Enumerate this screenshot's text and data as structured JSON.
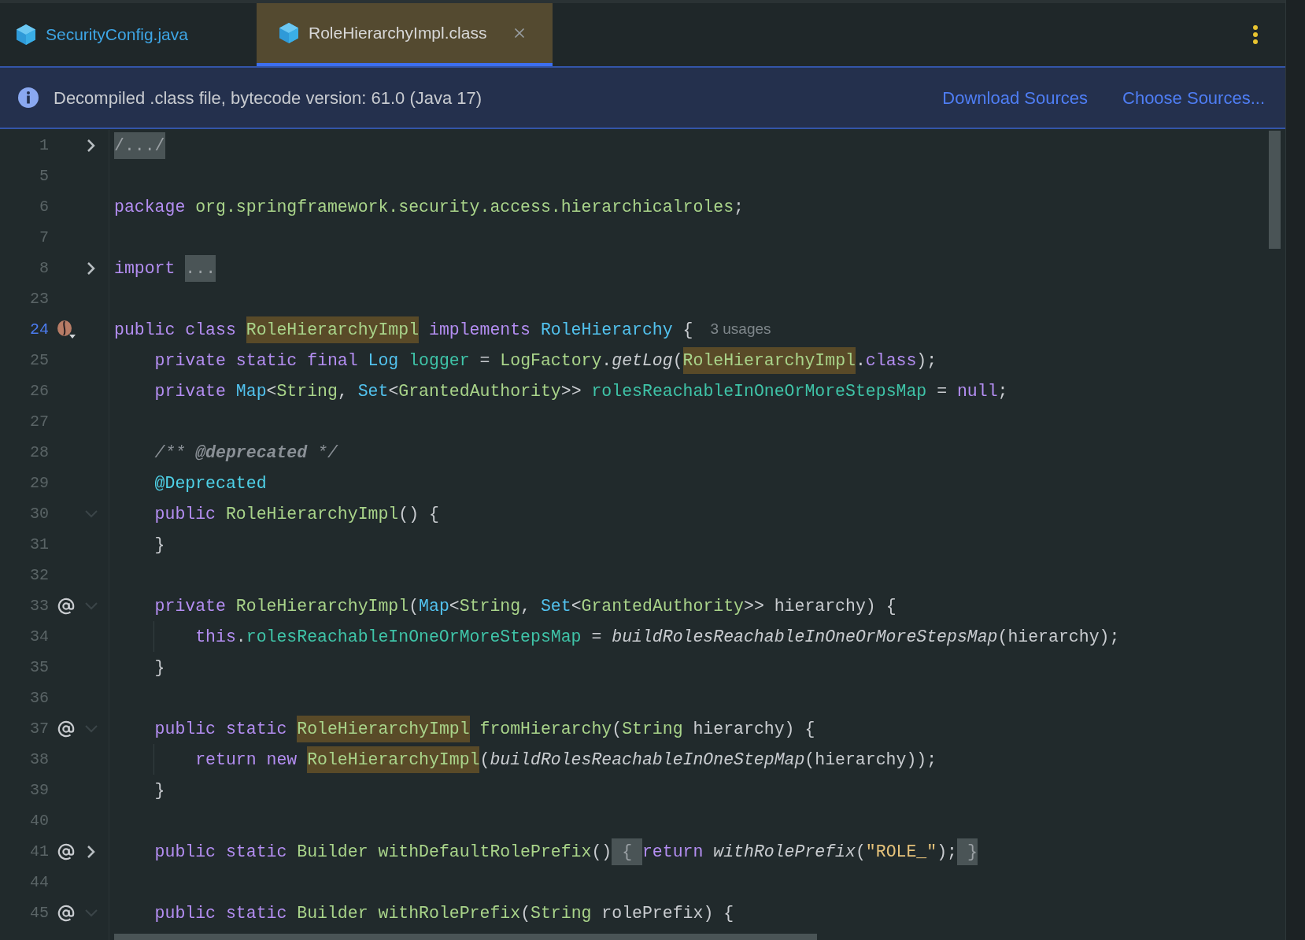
{
  "tabs": [
    {
      "label": "SecurityConfig.java",
      "selected": false,
      "closable": false
    },
    {
      "label": "RoleHierarchyImpl.class",
      "selected": true,
      "closable": true
    }
  ],
  "banner": {
    "message": "Decompiled .class file, bytecode version: 61.0 (Java 17)",
    "links": [
      "Download Sources",
      "Choose Sources..."
    ]
  },
  "lines": [
    {
      "number": "1",
      "current": false,
      "fold": {
        "collapsed": true
      },
      "tokens": [
        {
          "kind": "fold_marker",
          "text": "/.../"
        }
      ]
    },
    {
      "number": "5",
      "current": false
    },
    {
      "number": "6",
      "current": false,
      "tokens": [
        {
          "kind": "keyword",
          "text": "package "
        },
        {
          "kind": "package",
          "text": "org.springframework.security.access.hierarchicalroles"
        },
        {
          "kind": "plain",
          "text": ";"
        }
      ]
    },
    {
      "number": "7",
      "current": false
    },
    {
      "number": "8",
      "current": false,
      "fold": {
        "collapsed": true
      },
      "tokens": [
        {
          "kind": "keyword",
          "text": "import "
        },
        {
          "kind": "fold_marker",
          "text": "..."
        }
      ]
    },
    {
      "number": "23",
      "current": false
    },
    {
      "number": "24",
      "current": true,
      "gutter": {
        "kind": "bean"
      },
      "hint": "3 usages",
      "tokens": [
        {
          "kind": "keyword",
          "text": "public class "
        },
        {
          "kind": "class_match",
          "text": "RoleHierarchyImpl"
        },
        {
          "kind": "keyword",
          "text": " implements "
        },
        {
          "kind": "interface",
          "text": "RoleHierarchy"
        },
        {
          "kind": "plain",
          "text": " {"
        }
      ]
    },
    {
      "number": "25",
      "current": false,
      "tokens": [
        {
          "kind": "keyword",
          "text": "    private static final "
        },
        {
          "kind": "interface",
          "text": "Log"
        },
        {
          "kind": "field",
          "text": " logger"
        },
        {
          "kind": "plain",
          "text": " = "
        },
        {
          "kind": "class",
          "text": "LogFactory"
        },
        {
          "kind": "plain",
          "text": "."
        },
        {
          "kind": "static_call",
          "text": "getLog"
        },
        {
          "kind": "plain",
          "text": "("
        },
        {
          "kind": "class_match",
          "text": "RoleHierarchyImpl"
        },
        {
          "kind": "plain",
          "text": "."
        },
        {
          "kind": "keyword",
          "text": "class"
        },
        {
          "kind": "plain",
          "text": ");"
        }
      ]
    },
    {
      "number": "26",
      "current": false,
      "tokens": [
        {
          "kind": "keyword",
          "text": "    private "
        },
        {
          "kind": "interface",
          "text": "Map"
        },
        {
          "kind": "plain",
          "text": "<"
        },
        {
          "kind": "class",
          "text": "String"
        },
        {
          "kind": "plain",
          "text": ", "
        },
        {
          "kind": "interface",
          "text": "Set"
        },
        {
          "kind": "plain",
          "text": "<"
        },
        {
          "kind": "class",
          "text": "GrantedAuthority"
        },
        {
          "kind": "plain",
          "text": ">> "
        },
        {
          "kind": "field",
          "text": "rolesReachableInOneOrMoreStepsMap"
        },
        {
          "kind": "plain",
          "text": " = "
        },
        {
          "kind": "keyword",
          "text": "null"
        },
        {
          "kind": "plain",
          "text": ";"
        }
      ]
    },
    {
      "number": "27",
      "current": false
    },
    {
      "number": "28",
      "current": false,
      "tokens": [
        {
          "kind": "comment",
          "text": "    /** "
        },
        {
          "kind": "comment_tag",
          "text": "@deprecated"
        },
        {
          "kind": "comment",
          "text": " */"
        }
      ]
    },
    {
      "number": "29",
      "current": false,
      "tokens": [
        {
          "kind": "annotation",
          "text": "    @Deprecated"
        }
      ]
    },
    {
      "number": "30",
      "current": false,
      "fold": {
        "collapsed": false
      },
      "tokens": [
        {
          "kind": "keyword",
          "text": "    public "
        },
        {
          "kind": "method",
          "text": "RoleHierarchyImpl"
        },
        {
          "kind": "plain",
          "text": "() {"
        }
      ]
    },
    {
      "number": "31",
      "current": false,
      "tokens": [
        {
          "kind": "plain",
          "text": "    }"
        }
      ]
    },
    {
      "number": "32",
      "current": false
    },
    {
      "number": "33",
      "current": false,
      "gutter": {
        "kind": "at"
      },
      "fold": {
        "collapsed": false
      },
      "tokens": [
        {
          "kind": "keyword",
          "text": "    private "
        },
        {
          "kind": "method",
          "text": "RoleHierarchyImpl"
        },
        {
          "kind": "plain",
          "text": "("
        },
        {
          "kind": "interface",
          "text": "Map"
        },
        {
          "kind": "plain",
          "text": "<"
        },
        {
          "kind": "class",
          "text": "String"
        },
        {
          "kind": "plain",
          "text": ", "
        },
        {
          "kind": "interface",
          "text": "Set"
        },
        {
          "kind": "plain",
          "text": "<"
        },
        {
          "kind": "class",
          "text": "GrantedAuthority"
        },
        {
          "kind": "plain",
          "text": ">> hierarchy) {"
        }
      ]
    },
    {
      "number": "34",
      "current": false,
      "tokens": [
        {
          "kind": "keyword",
          "text": "        this"
        },
        {
          "kind": "plain",
          "text": "."
        },
        {
          "kind": "field",
          "text": "rolesReachableInOneOrMoreStepsMap"
        },
        {
          "kind": "plain",
          "text": " = "
        },
        {
          "kind": "static_call",
          "text": "buildRolesReachableInOneOrMoreStepsMap"
        },
        {
          "kind": "plain",
          "text": "(hierarchy);"
        }
      ]
    },
    {
      "number": "35",
      "current": false,
      "tokens": [
        {
          "kind": "plain",
          "text": "    }"
        }
      ]
    },
    {
      "number": "36",
      "current": false
    },
    {
      "number": "37",
      "current": false,
      "gutter": {
        "kind": "at"
      },
      "fold": {
        "collapsed": false
      },
      "tokens": [
        {
          "kind": "keyword",
          "text": "    public static "
        },
        {
          "kind": "class_match",
          "text": "RoleHierarchyImpl"
        },
        {
          "kind": "method",
          "text": " fromHierarchy"
        },
        {
          "kind": "plain",
          "text": "("
        },
        {
          "kind": "class",
          "text": "String"
        },
        {
          "kind": "plain",
          "text": " hierarchy) {"
        }
      ]
    },
    {
      "number": "38",
      "current": false,
      "tokens": [
        {
          "kind": "keyword",
          "text": "        return new "
        },
        {
          "kind": "class_match",
          "text": "RoleHierarchyImpl"
        },
        {
          "kind": "plain",
          "text": "("
        },
        {
          "kind": "static_call",
          "text": "buildRolesReachableInOneStepMap"
        },
        {
          "kind": "plain",
          "text": "(hierarchy));"
        }
      ]
    },
    {
      "number": "39",
      "current": false,
      "tokens": [
        {
          "kind": "plain",
          "text": "    }"
        }
      ]
    },
    {
      "number": "40",
      "current": false
    },
    {
      "number": "41",
      "current": false,
      "gutter": {
        "kind": "at"
      },
      "fold": {
        "collapsed": true
      },
      "tokens": [
        {
          "kind": "keyword",
          "text": "    public static "
        },
        {
          "kind": "class",
          "text": "Builder"
        },
        {
          "kind": "method",
          "text": " withDefaultRolePrefix"
        },
        {
          "kind": "plain",
          "text": "()"
        },
        {
          "kind": "fold_marker",
          "text": " { "
        },
        {
          "kind": "keyword",
          "text": "return "
        },
        {
          "kind": "static_call",
          "text": "withRolePrefix"
        },
        {
          "kind": "plain",
          "text": "("
        },
        {
          "kind": "string",
          "text": "\"ROLE_\""
        },
        {
          "kind": "plain",
          "text": ");"
        },
        {
          "kind": "fold_marker",
          "text": " }"
        }
      ]
    },
    {
      "number": "44",
      "current": false
    },
    {
      "number": "45",
      "current": false,
      "gutter": {
        "kind": "at"
      },
      "fold": {
        "collapsed": false
      },
      "tokens": [
        {
          "kind": "keyword",
          "text": "    public static "
        },
        {
          "kind": "class",
          "text": "Builder"
        },
        {
          "kind": "method",
          "text": " withRolePrefix"
        },
        {
          "kind": "plain",
          "text": "("
        },
        {
          "kind": "class",
          "text": "String"
        },
        {
          "kind": "plain",
          "text": " rolePrefix) {"
        }
      ]
    }
  ]
}
